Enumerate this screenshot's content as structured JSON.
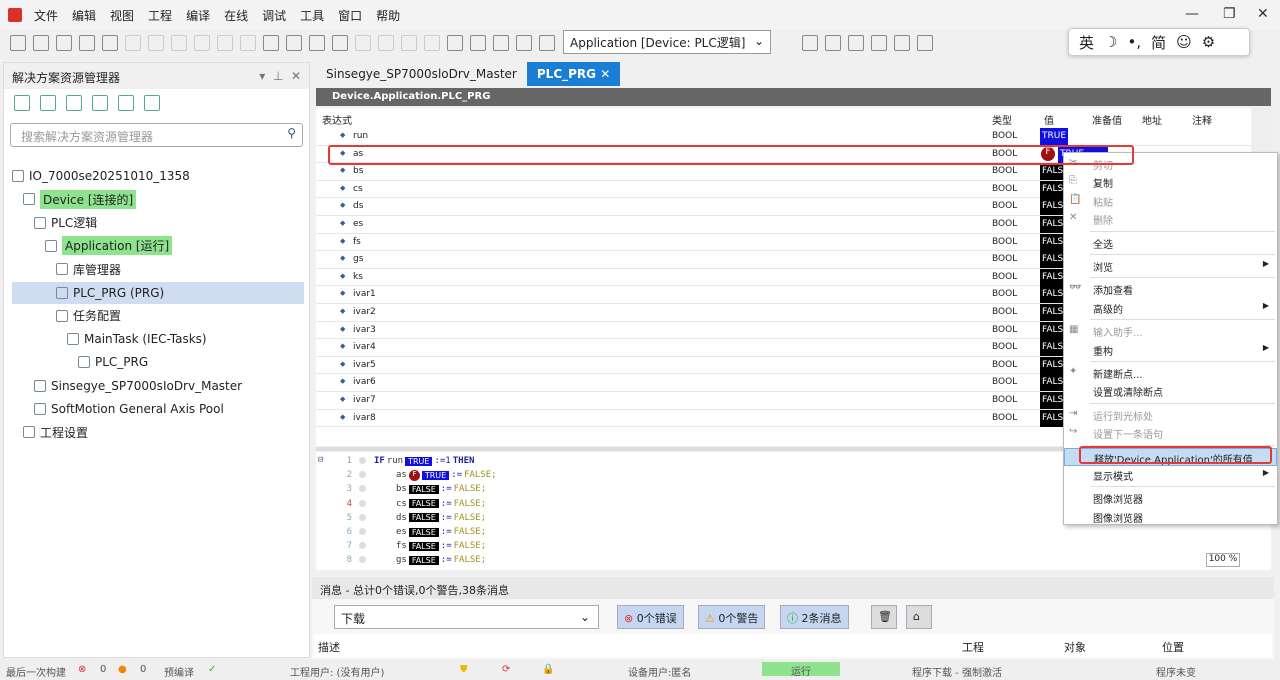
{
  "menu": [
    "文件",
    "编辑",
    "视图",
    "工程",
    "编译",
    "在线",
    "调试",
    "工具",
    "窗口",
    "帮助"
  ],
  "toolbar": {
    "app_select": "Application [Device: PLC逻辑]"
  },
  "ime": [
    "英",
    "☽",
    "•,",
    "简",
    "☺",
    "⚙"
  ],
  "left": {
    "title": "解决方案资源管理器",
    "search_placeholder": "搜索解决方案资源管理器",
    "tree": [
      {
        "label": "IO_7000se20251010_1358",
        "indent": 0
      },
      {
        "label": "Device [连接的]",
        "indent": 1,
        "hl": true
      },
      {
        "label": "PLC逻辑",
        "indent": 2
      },
      {
        "label": "Application [运行]",
        "indent": 3,
        "hl": true
      },
      {
        "label": "库管理器",
        "indent": 4
      },
      {
        "label": "PLC_PRG (PRG)",
        "indent": 4,
        "sel": true
      },
      {
        "label": "任务配置",
        "indent": 4
      },
      {
        "label": "MainTask (IEC-Tasks)",
        "indent": 5
      },
      {
        "label": "PLC_PRG",
        "indent": 6
      },
      {
        "label": "Sinsegye_SP7000sIoDrv_Master",
        "indent": 2
      },
      {
        "label": "SoftMotion General Axis Pool",
        "indent": 2
      },
      {
        "label": "工程设置",
        "indent": 1
      }
    ]
  },
  "tabs": [
    "Sinsegye_SP7000sloDrv_Master",
    "PLC_PRG"
  ],
  "path": "Device.Application.PLC_PRG",
  "watch": {
    "headers": [
      "表达式",
      "类型",
      "值",
      "准备值",
      "地址",
      "注释"
    ],
    "rows": [
      {
        "name": "run",
        "type": "BOOL",
        "value": "TRUE"
      },
      {
        "name": "as",
        "type": "BOOL",
        "value": "TRUE",
        "forced": true
      },
      {
        "name": "bs",
        "type": "BOOL",
        "value": "FALSE"
      },
      {
        "name": "cs",
        "type": "BOOL",
        "value": "FALSE"
      },
      {
        "name": "ds",
        "type": "BOOL",
        "value": "FALSE"
      },
      {
        "name": "es",
        "type": "BOOL",
        "value": "FALSE"
      },
      {
        "name": "fs",
        "type": "BOOL",
        "value": "FALSE"
      },
      {
        "name": "gs",
        "type": "BOOL",
        "value": "FALSE"
      },
      {
        "name": "ks",
        "type": "BOOL",
        "value": "FALSE"
      },
      {
        "name": "ivar1",
        "type": "BOOL",
        "value": "FALSE"
      },
      {
        "name": "ivar2",
        "type": "BOOL",
        "value": "FALSE"
      },
      {
        "name": "ivar3",
        "type": "BOOL",
        "value": "FALSE"
      },
      {
        "name": "ivar4",
        "type": "BOOL",
        "value": "FALSE"
      },
      {
        "name": "ivar5",
        "type": "BOOL",
        "value": "FALSE"
      },
      {
        "name": "ivar6",
        "type": "BOOL",
        "value": "FALSE"
      },
      {
        "name": "ivar7",
        "type": "BOOL",
        "value": "FALSE"
      },
      {
        "name": "ivar8",
        "type": "BOOL",
        "value": "FALSE"
      }
    ]
  },
  "code": [
    {
      "n": "1",
      "v": "run",
      "val": "TRUE",
      "rest": ":=1",
      "kw2": "THEN",
      "kw": "IF"
    },
    {
      "n": "2",
      "v": "as",
      "val": "TRUE",
      "forced": true,
      "rest": ":=",
      "f": "FALSE;"
    },
    {
      "n": "3",
      "v": "bs",
      "val": "FALSE",
      "rest": ":=",
      "f": "FALSE;"
    },
    {
      "n": "4",
      "v": "cs",
      "val": "FALSE",
      "rest": ":=",
      "f": "FALSE;"
    },
    {
      "n": "5",
      "v": "ds",
      "val": "FALSE",
      "rest": ":=",
      "f": "FALSE;"
    },
    {
      "n": "6",
      "v": "es",
      "val": "FALSE",
      "rest": ":=",
      "f": "FALSE;"
    },
    {
      "n": "7",
      "v": "fs",
      "val": "FALSE",
      "rest": ":=",
      "f": "FALSE;"
    },
    {
      "n": "8",
      "v": "gs",
      "val": "FALSE",
      "rest": ":=",
      "f": "FALSE;"
    }
  ],
  "zoom": "100 %",
  "context_menu": [
    {
      "label": "剪切",
      "dis": true
    },
    {
      "label": "复制"
    },
    {
      "label": "粘贴",
      "dis": true
    },
    {
      "label": "删除",
      "dis": true
    },
    {
      "sep": true
    },
    {
      "label": "全选"
    },
    {
      "sep": true
    },
    {
      "label": "浏览",
      "sub": true
    },
    {
      "sep": true
    },
    {
      "label": "添加查看"
    },
    {
      "label": "高级的",
      "sub": true
    },
    {
      "sep": true
    },
    {
      "label": "输入助手...",
      "dis": true
    },
    {
      "label": "重构",
      "sub": true
    },
    {
      "sep": true
    },
    {
      "label": "新建断点..."
    },
    {
      "label": "设置或清除断点"
    },
    {
      "sep": true
    },
    {
      "label": "运行到光标处",
      "dis": true
    },
    {
      "label": "设置下一条语句",
      "dis": true
    },
    {
      "sep": true
    },
    {
      "label": "释放'Device.Application'的所有值",
      "hl": true
    },
    {
      "label": "显示模式",
      "sub": true
    },
    {
      "sep": true
    },
    {
      "label": "图像浏览器"
    },
    {
      "label": "图像浏览器"
    }
  ],
  "messages": {
    "title": "消息 - 总计0个错误,0个警告,38条消息",
    "filter": "下载",
    "errors": "0个错误",
    "warnings": "0个警告",
    "infos": "2条消息",
    "cols": [
      "描述",
      "工程",
      "对象",
      "位置"
    ]
  },
  "status": {
    "last_build": "最后一次构建",
    "err": "0",
    "warn": "0",
    "precompile": "预编译",
    "check": "✓",
    "proj_user": "工程用户: (没有用户)",
    "dev_user": "设备用户:匿名",
    "run": "运行",
    "download": "程序下载 - 强制激活",
    "unchanged": "程序未变"
  },
  "colors": {
    "accent": "#1a7fd4",
    "true_bg": "#1010e0",
    "false_bg": "#000000",
    "highlight": "#8ee38e",
    "annotation": "#e53935"
  }
}
